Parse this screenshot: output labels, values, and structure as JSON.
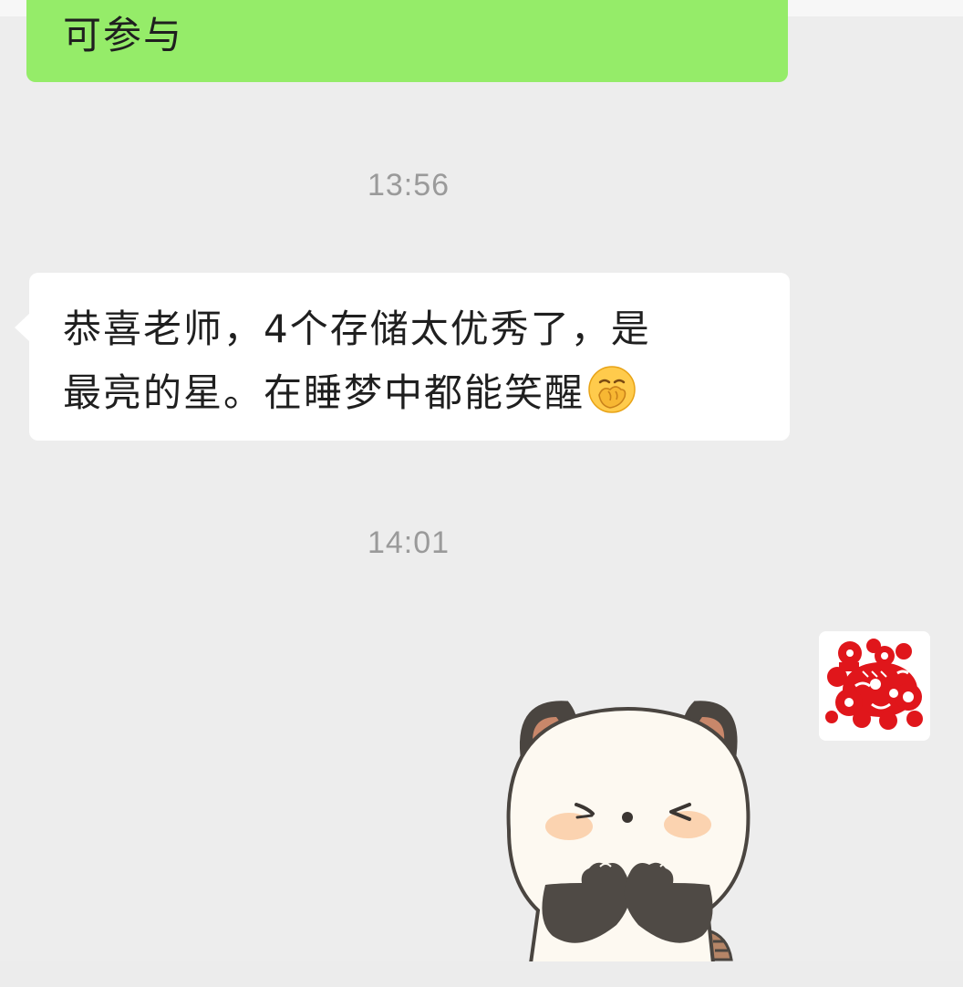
{
  "messages": {
    "sent_partial_text": "可参与",
    "received_line1": "恭喜老师，4个存储太优秀了，是",
    "received_line2": "最亮的星。在睡梦中都能笑醒"
  },
  "timestamps": {
    "first": "13:56",
    "second": "14:01"
  },
  "emoji": {
    "name": "hand-over-mouth-emoji"
  },
  "avatar": {
    "name": "red-papercut-tiger-avatar"
  },
  "sticker": {
    "name": "panda-giggling-sticker"
  },
  "colors": {
    "chat_background": "#ededed",
    "sent_bubble": "#95ec69",
    "received_bubble": "#ffffff",
    "timestamp_text": "#9a9a9a",
    "avatar_red": "#e0161b"
  }
}
